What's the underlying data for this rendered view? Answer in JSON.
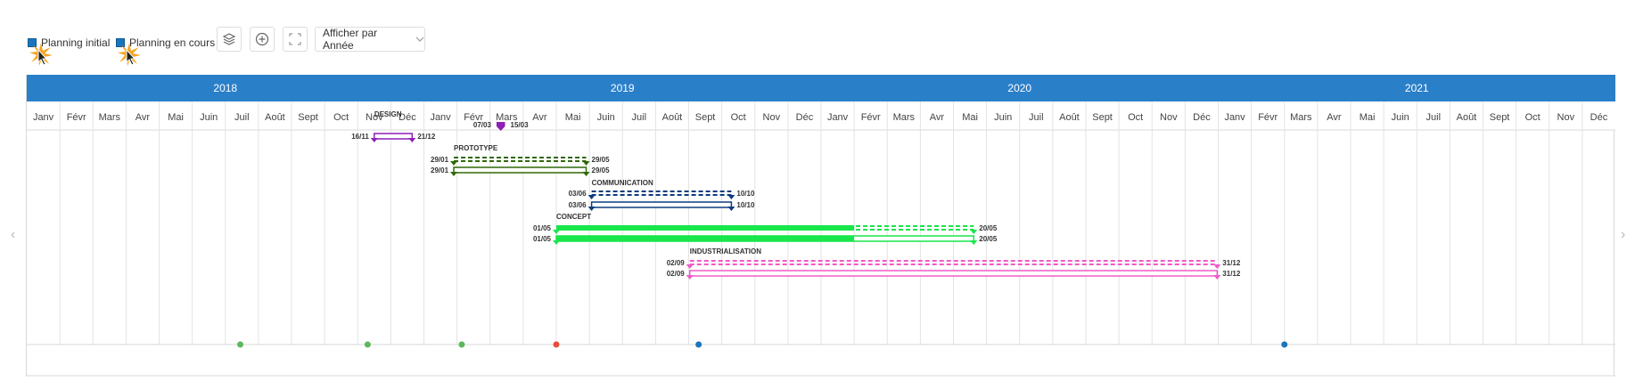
{
  "toolbar": {
    "checkbox_initial": "Planning initial",
    "checkbox_current": "Planning en cours",
    "layers_icon": "layers-icon",
    "add_icon": "plus-circle-icon",
    "fullscreen_icon": "expand-icon",
    "view_select": "Afficher par Année",
    "checkbox_color": "#1b75bb"
  },
  "timeline": {
    "header_color": "#2a7fc9",
    "years": [
      "2018",
      "2019",
      "2020",
      "2021"
    ],
    "months": [
      "Janv",
      "Févr",
      "Mars",
      "Avr",
      "Mai",
      "Juin",
      "Juil",
      "Août",
      "Sept",
      "Oct",
      "Nov",
      "Déc",
      "Janv",
      "Févr",
      "Mars",
      "Avr",
      "Mai",
      "Juin",
      "Juil",
      "Août",
      "Sept",
      "Oct",
      "Nov",
      "Déc",
      "Janv",
      "Févr",
      "Mars",
      "Avr",
      "Mai",
      "Juin",
      "Juil",
      "Août",
      "Sept",
      "Oct",
      "Nov",
      "Déc",
      "Janv",
      "Févr",
      "Mars",
      "Avr",
      "Mai",
      "Juin",
      "Juil",
      "Août",
      "Sept",
      "Oct",
      "Nov",
      "Déc"
    ]
  },
  "tasks": [
    {
      "label": "DESIGN",
      "color": "#8e1fb8",
      "current": {
        "start": "2018-11-16",
        "end": "2018-12-21",
        "start_label": "16/11",
        "end_label": "21/12"
      },
      "milestone": {
        "start": "2019-03-07",
        "end": "2019-03-15",
        "start_label": "07/03",
        "end_label": "15/03"
      }
    },
    {
      "label": "PROTOTYPE",
      "color": "#2f6a06",
      "planned": {
        "start": "2019-01-29",
        "end": "2019-05-29",
        "start_label": "29/01",
        "end_label": "29/05"
      },
      "current": {
        "start": "2019-01-29",
        "end": "2019-05-29",
        "start_label": "29/01",
        "end_label": "29/05"
      }
    },
    {
      "label": "COMMUNICATION",
      "color": "#0d3c7e",
      "planned": {
        "start": "2019-06-03",
        "end": "2019-10-10",
        "start_label": "03/06",
        "end_label": "10/10"
      },
      "current": {
        "start": "2019-06-03",
        "end": "2019-10-10",
        "start_label": "03/06",
        "end_label": "10/10"
      }
    },
    {
      "label": "CONCEPT",
      "color": "#18e64a",
      "planned": {
        "start": "2019-05-01",
        "end": "2020-05-20",
        "start_label": "01/05",
        "end_label": "20/05",
        "progress_until": "2020-02-01"
      },
      "current": {
        "start": "2019-05-01",
        "end": "2020-05-20",
        "start_label": "01/05",
        "end_label": "20/05",
        "progress_until": "2020-02-01"
      }
    },
    {
      "label": "INDUSTRIALISATION",
      "color": "#f05ac8",
      "planned": {
        "start": "2019-09-02",
        "end": "2020-12-31",
        "start_label": "02/09",
        "end_label": "31/12"
      },
      "current": {
        "start": "2019-09-02",
        "end": "2020-12-31",
        "start_label": "02/09",
        "end_label": "31/12"
      }
    }
  ],
  "markers": [
    {
      "date": "2018-07-15",
      "color": "#5cb85c"
    },
    {
      "date": "2018-11-10",
      "color": "#5cb85c"
    },
    {
      "date": "2019-02-05",
      "color": "#5cb85c"
    },
    {
      "date": "2019-05-01",
      "color": "#e74c3c"
    },
    {
      "date": "2019-09-10",
      "color": "#1b75bb"
    },
    {
      "date": "2021-03-01",
      "color": "#1b75bb"
    }
  ]
}
